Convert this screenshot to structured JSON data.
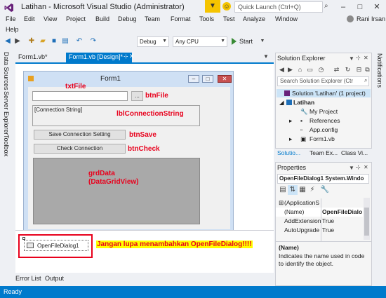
{
  "window": {
    "title": "Latihan - Microsoft Visual Studio (Administrator)",
    "quick_launch_placeholder": "Quick Launch (Ctrl+Q)",
    "user_name": "Rani Irsan"
  },
  "menu": [
    "File",
    "Edit",
    "View",
    "Project",
    "Build",
    "Debug",
    "Team",
    "Format",
    "Tools",
    "Test",
    "Analyze",
    "Window"
  ],
  "menu_help": "Help",
  "toolbar": {
    "config": "Debug",
    "platform": "Any CPU",
    "start_label": "Start"
  },
  "left_tabs": [
    "Data Sources",
    "Server Explorer",
    "Toolbox"
  ],
  "right_tab": "Notifications",
  "doc_tabs": {
    "inactive": "Form1.vb*",
    "active": "Form1.vb [Design]*"
  },
  "form": {
    "title": "Form1",
    "btnfile_label": "...",
    "lbl_conn_text": "[Connection String]",
    "btn_save_label": "Save Connection Setting",
    "btn_check_label": "Check Connection"
  },
  "annotations": {
    "txtfile": "txtFile",
    "btnfile": "btnFile",
    "lblconn": "lblConnectionString",
    "btnsave": "btnSave",
    "btncheck": "btnCheck",
    "grd_line1": "grdData",
    "grd_line2": "(DataGridView)"
  },
  "tray": {
    "component": "OpenFileDialog1",
    "note": "Jangan lupa menambahkan OpenFileDialog!!!!"
  },
  "bottom_tabs": [
    "Error List",
    "Output"
  ],
  "status": "Ready",
  "solution_explorer": {
    "title": "Solution Explorer",
    "search_placeholder": "Search Solution Explorer (Ctr",
    "solution": "Solution 'Latihan' (1 project)",
    "project": "Latihan",
    "items": [
      "My Project",
      "References",
      "App.config",
      "Form1.vb"
    ],
    "tabs": [
      "Solutio...",
      "Team Ex...",
      "Class Vi..."
    ]
  },
  "properties": {
    "title": "Properties",
    "object": "OpenFileDialog1  System.Windo",
    "rows": [
      {
        "name": "(ApplicationS",
        "value": ""
      },
      {
        "name": "(Name)",
        "value": "OpenFileDialo"
      },
      {
        "name": "AddExtension",
        "value": "True"
      },
      {
        "name": "AutoUpgrade",
        "value": "True"
      }
    ],
    "desc_title": "(Name)",
    "desc_text": "Indicates the name used in code to identify the object."
  },
  "colors": {
    "accent": "#007acc",
    "annotation_red": "#e8001c",
    "note_highlight": "#ffff00",
    "grid_gray": "#a9a9a9"
  }
}
